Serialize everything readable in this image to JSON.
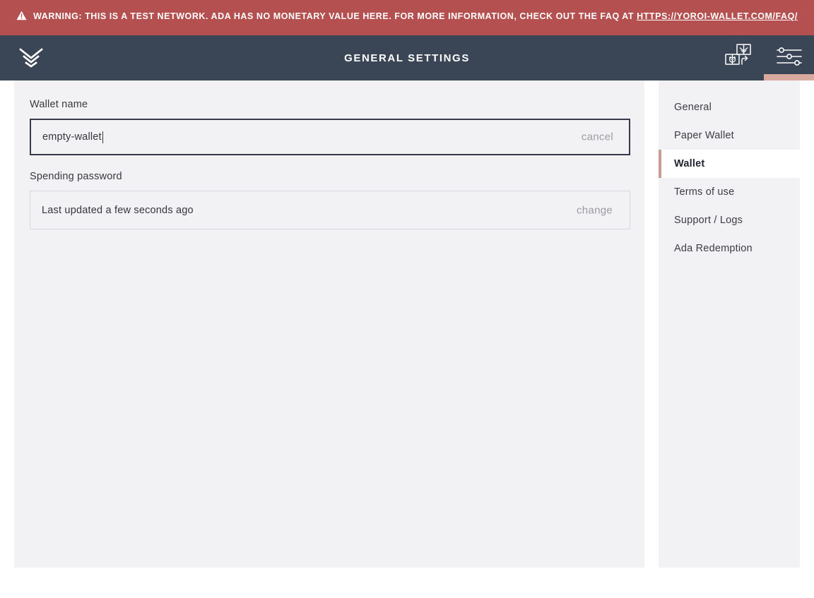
{
  "banner": {
    "icon": "warning-triangle-icon",
    "text_before_link": "WARNING: THIS IS A TEST NETWORK. ADA HAS NO MONETARY VALUE HERE. FOR MORE INFORMATION, CHECK OUT THE FAQ AT ",
    "link_text": "HTTPS://YOROI-WALLET.COM/FAQ/",
    "background_color": "#b55050",
    "text_color": "#ffffff"
  },
  "topbar": {
    "logo_icon": "yoroi-chevron-logo-icon",
    "title": "GENERAL SETTINGS",
    "background_color": "#3a4555",
    "actions": [
      {
        "name": "wallet-switch-icon",
        "label": "Switch wallet",
        "active": false
      },
      {
        "name": "settings-sliders-icon",
        "label": "Settings",
        "active": true
      }
    ],
    "active_indicator_color": "#d9a9a0"
  },
  "main": {
    "wallet_name": {
      "label": "Wallet name",
      "value": "empty-wallet",
      "placeholder": "Wallet name",
      "action_label": "cancel",
      "focused": true
    },
    "spending_password": {
      "label": "Spending password",
      "status_text": "Last updated a few seconds ago",
      "action_label": "change"
    }
  },
  "sidebar": {
    "items": [
      {
        "label": "General",
        "active": false
      },
      {
        "label": "Paper Wallet",
        "active": false
      },
      {
        "label": "Wallet",
        "active": true
      },
      {
        "label": "Terms of use",
        "active": false
      },
      {
        "label": "Support / Logs",
        "active": false
      },
      {
        "label": "Ada Redemption",
        "active": false
      }
    ],
    "active_accent_color": "#cb9a93"
  }
}
